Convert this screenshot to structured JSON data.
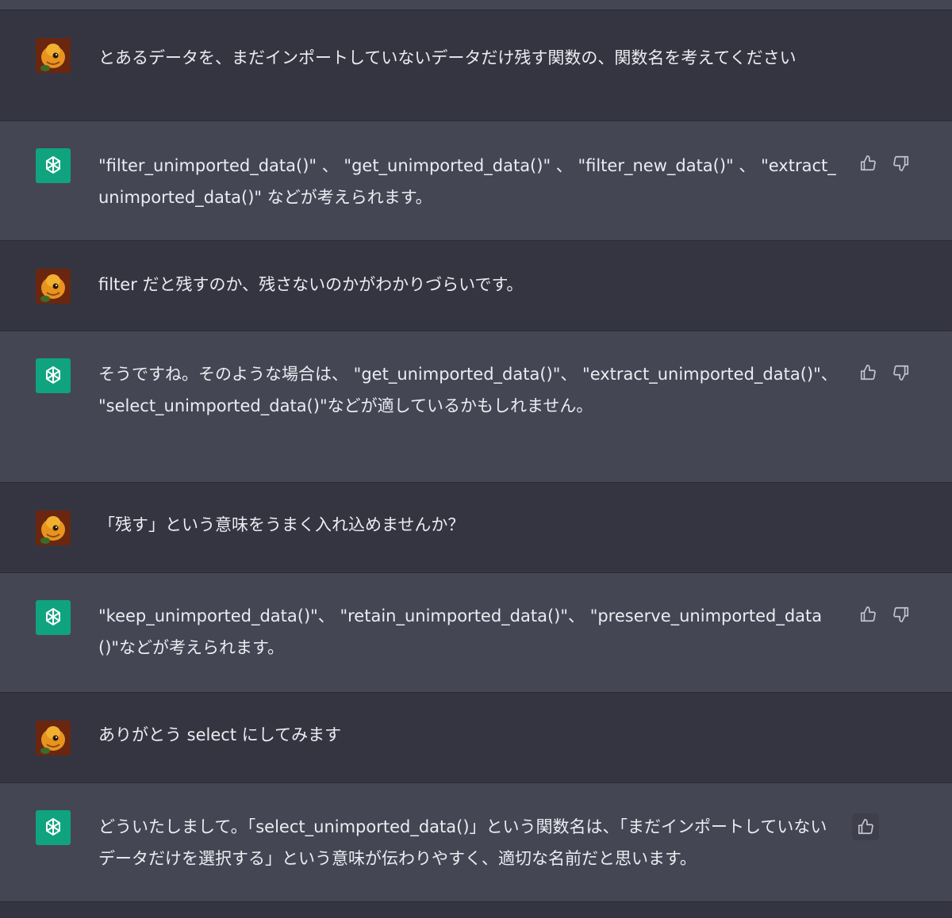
{
  "conversation": [
    {
      "role": "user",
      "text": "とあるデータを、まだインポートしていないデータだけ残す関数の、関数名を考えてください"
    },
    {
      "role": "assistant",
      "text": "\"filter_unimported_data()\" 、 \"get_unimported_data()\" 、 \"filter_new_data()\" 、 \"extract_unimported_data()\" などが考えられます。"
    },
    {
      "role": "user",
      "text": "filter だと残すのか、残さないのかがわかりづらいです。"
    },
    {
      "role": "assistant",
      "text": "そうですね。そのような場合は、 \"get_unimported_data()\"、 \"extract_unimported_data()\"、 \"select_unimported_data()\"などが適しているかもしれません。"
    },
    {
      "role": "user",
      "text": "「残す」という意味をうまく入れ込めませんか？"
    },
    {
      "role": "assistant",
      "text": "\"keep_unimported_data()\"、 \"retain_unimported_data()\"、 \"preserve_unimported_data()\"などが考えられます。"
    },
    {
      "role": "user",
      "text": "ありがとう select にしてみます"
    },
    {
      "role": "assistant",
      "text": "どういたしまして。「select_unimported_data()」という関数名は、「まだインポートしていないデータだけを選択する」という意味が伝わりやすく、適切な名前だと思います。"
    }
  ],
  "icons": {
    "user_avatar": "user-avatar",
    "assistant_avatar": "openai-logo-icon",
    "like": "thumbs-up-icon",
    "dislike": "thumbs-down-icon"
  },
  "colors": {
    "user_bg": "#343541",
    "assistant_bg": "#444654",
    "accent": "#10a37f"
  }
}
